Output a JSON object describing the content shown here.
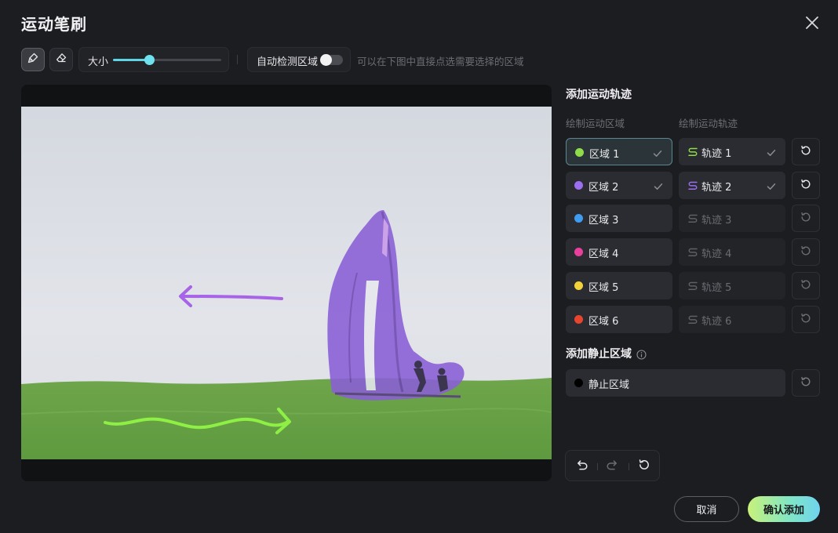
{
  "dialog": {
    "title": "运动笔刷",
    "close_icon": "close-icon"
  },
  "toolbar": {
    "brush_icon": "brush-icon",
    "eraser_icon": "eraser-icon",
    "size_label": "大小",
    "size_value": 0.33,
    "auto_detect_label": "自动检测区域",
    "auto_detect_on": false,
    "hint": "可以在下图中直接点选需要选择的区域"
  },
  "panel": {
    "motion_title": "添加运动轨迹",
    "col_region": "绘制运动区域",
    "col_track": "绘制运动轨迹",
    "rows": [
      {
        "region": "区域 1",
        "track": "轨迹 1",
        "color": "#8fdc4a",
        "done": true,
        "selected": true
      },
      {
        "region": "区域 2",
        "track": "轨迹 2",
        "color": "#9b6ff0",
        "done": true,
        "selected": false
      },
      {
        "region": "区域 3",
        "track": "轨迹 3",
        "color": "#3f9cf0",
        "done": false,
        "selected": false
      },
      {
        "region": "区域 4",
        "track": "轨迹 4",
        "color": "#e8409c",
        "done": false,
        "selected": false
      },
      {
        "region": "区域 5",
        "track": "轨迹 5",
        "color": "#f2d23a",
        "done": false,
        "selected": false
      },
      {
        "region": "区域 6",
        "track": "轨迹 6",
        "color": "#e8452e",
        "done": false,
        "selected": false
      }
    ],
    "static_title": "添加静止区域",
    "static_label": "静止区域",
    "static_color": "#000000"
  },
  "footer": {
    "cancel": "取消",
    "confirm": "确认添加"
  }
}
